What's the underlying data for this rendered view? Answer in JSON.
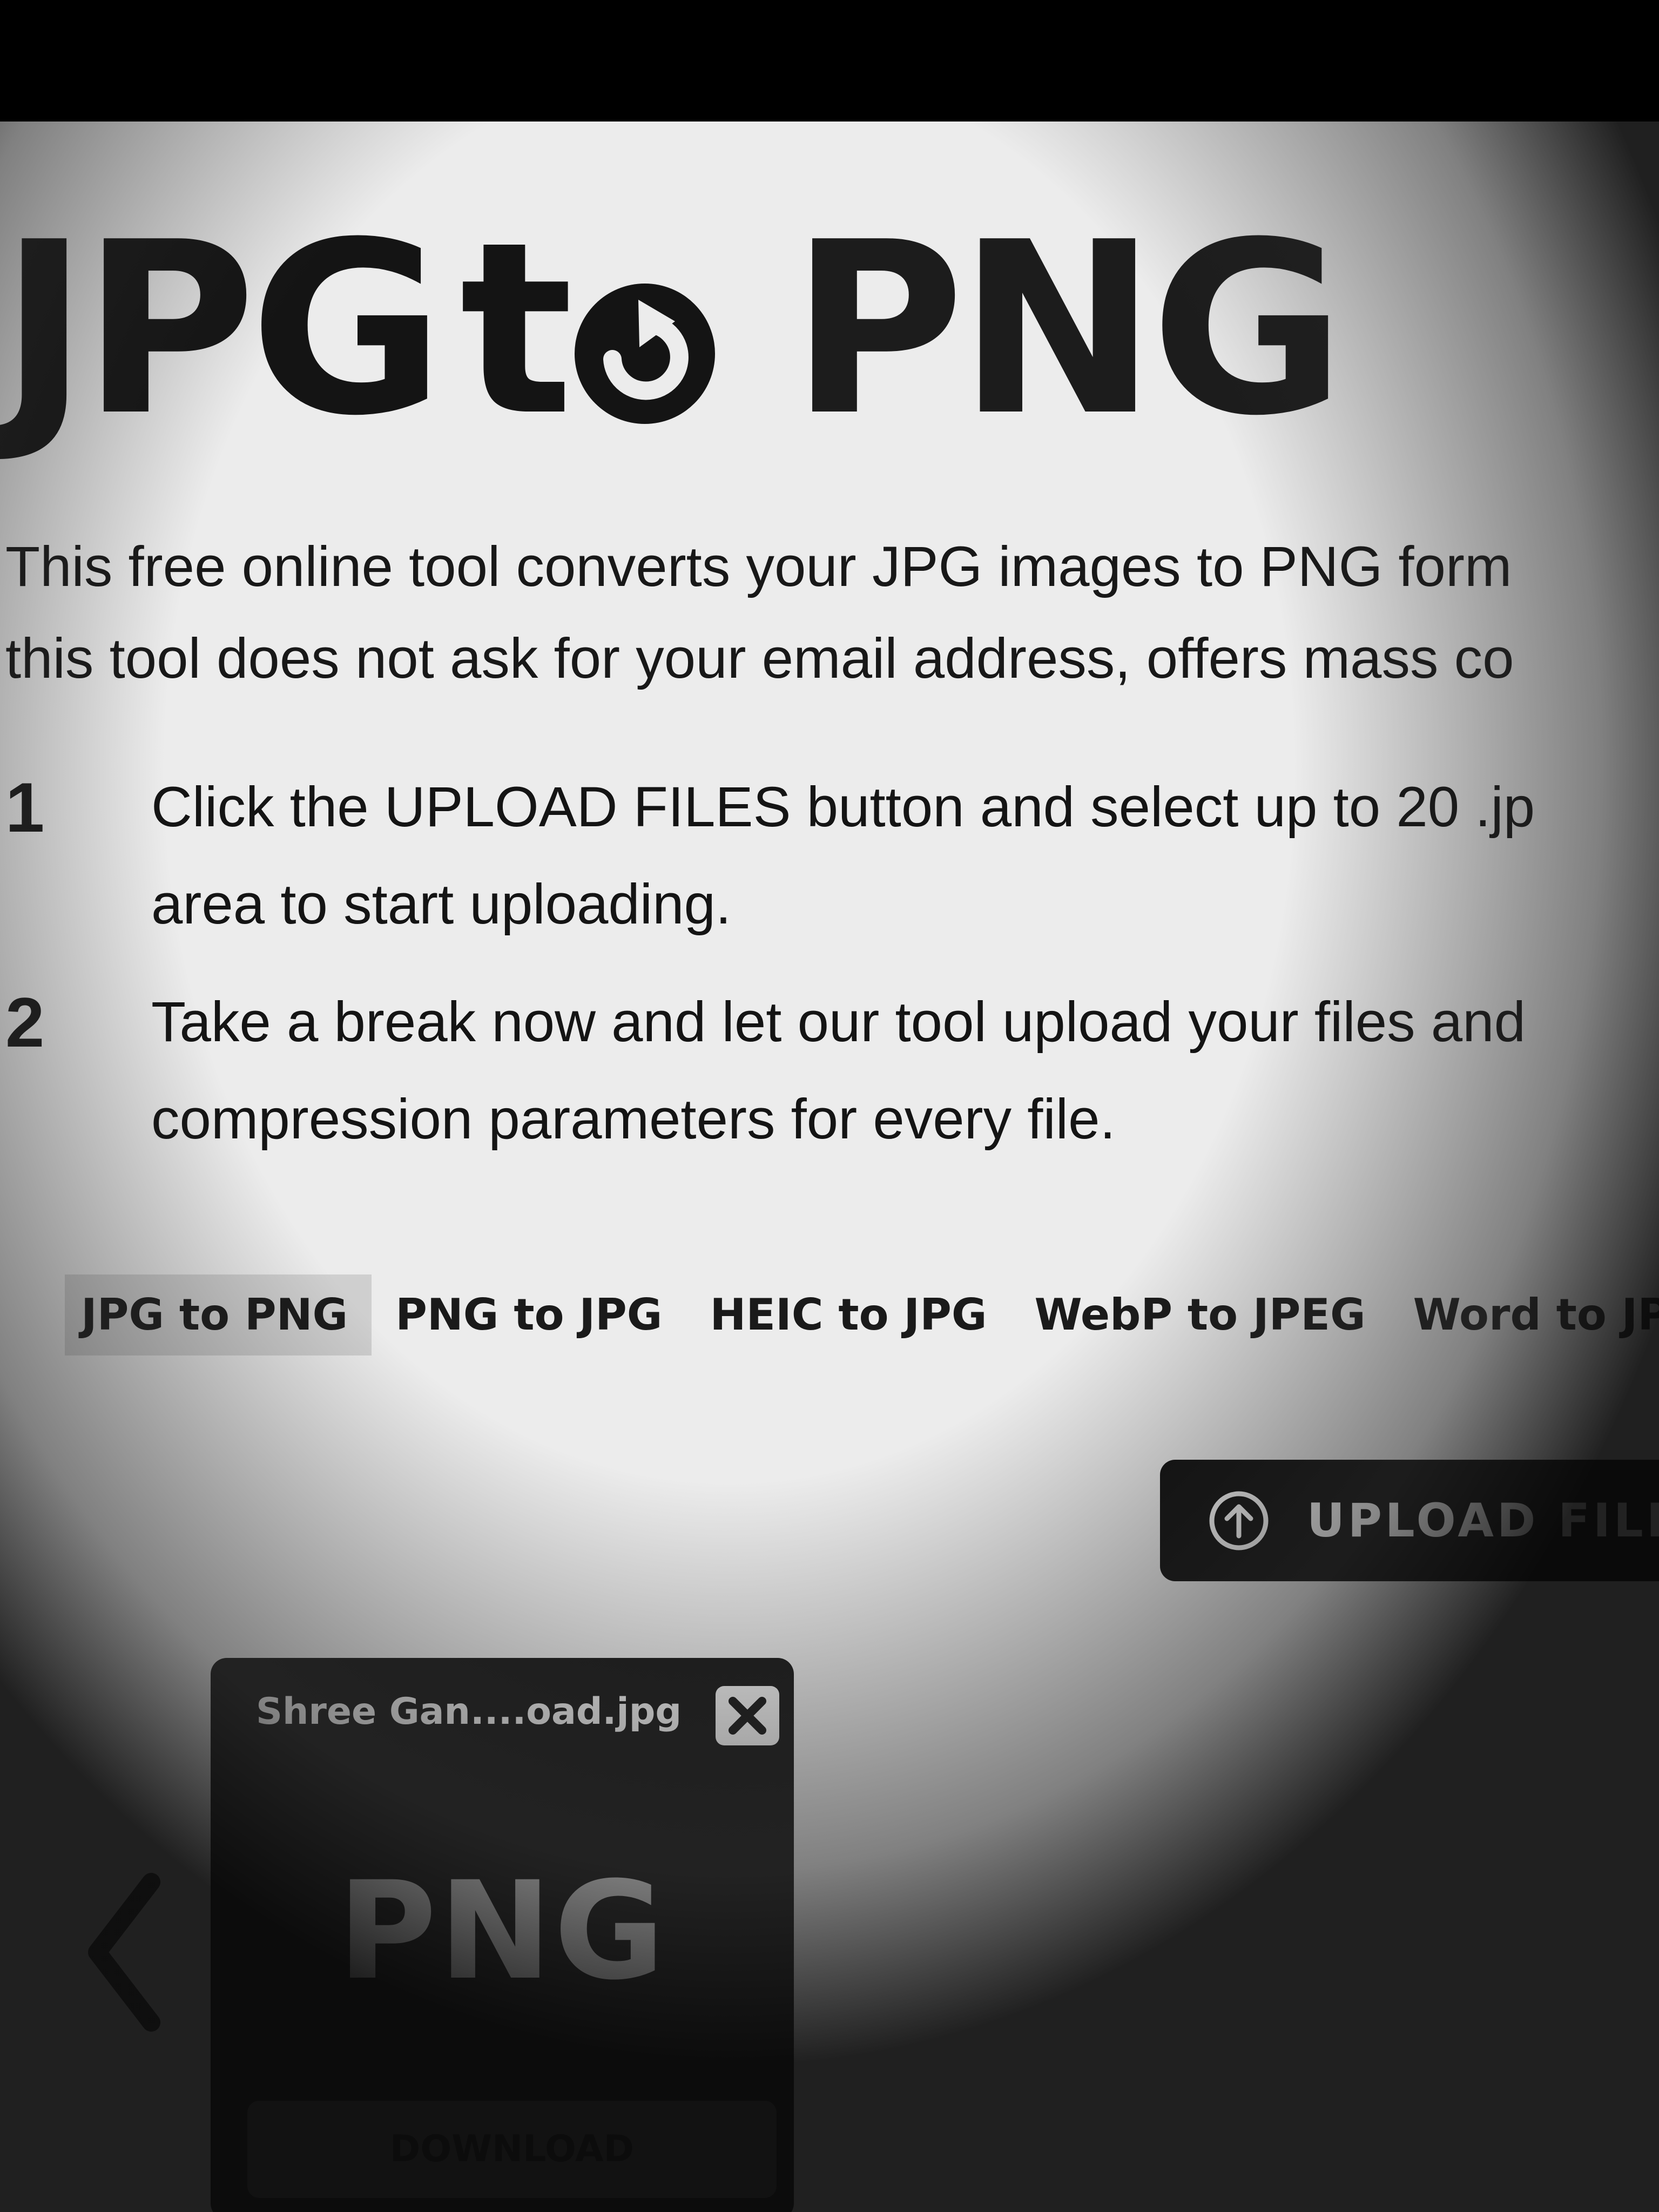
{
  "logo": {
    "part_jpg": "JPG",
    "part_to": "t",
    "part_png": "PNG"
  },
  "intro": {
    "line1": "This free online tool converts your JPG images to PNG form",
    "line2": "this tool does not ask for your email address, offers mass co"
  },
  "steps": [
    {
      "number": "1",
      "line1": "Click the UPLOAD FILES button and select up to 20 .jp",
      "line2": "area to start uploading."
    },
    {
      "number": "2",
      "line1": "Take a break now and let our tool upload your files and",
      "line2": "compression parameters for every file."
    }
  ],
  "tabs": [
    {
      "label": "JPG to PNG",
      "active": true
    },
    {
      "label": "PNG to JPG",
      "active": false
    },
    {
      "label": "HEIC to JPG",
      "active": false
    },
    {
      "label": "WebP to JPEG",
      "active": false
    },
    {
      "label": "Word to JPEG",
      "active": false
    }
  ],
  "upload_button": {
    "label": "UPLOAD FILE",
    "icon": "arrow-up-circle-icon"
  },
  "file_card": {
    "filename": "Shree Gan....oad.jpg",
    "format": "PNG",
    "download_label": "DOWNLOAD",
    "close_icon": "close-icon"
  },
  "colors": {
    "top_bar": "#000000",
    "upload_button_bg": "#0e0e0e",
    "card_bg": "#1b1b1b",
    "active_tab_bg": "#cfcfcf"
  }
}
